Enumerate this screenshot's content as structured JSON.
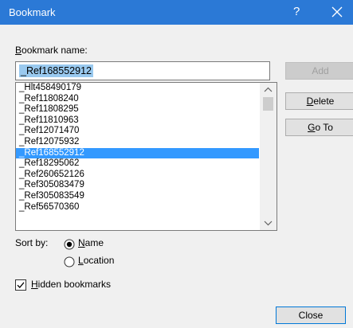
{
  "window": {
    "title": "Bookmark",
    "help": "?",
    "title_bar_color": "#2b79d6"
  },
  "bookmark_name": {
    "label_accel": "B",
    "label_rest": "ookmark name:",
    "value": "_Ref168552912"
  },
  "bookmarks": {
    "items": [
      "_Hlt458490179",
      "_Ref11808240",
      "_Ref11808295",
      "_Ref11810963",
      "_Ref12071470",
      "_Ref12075932",
      "_Ref168552912",
      "_Ref18295062",
      "_Ref260652126",
      "_Ref305083479",
      "_Ref305083549",
      "_Ref56570360"
    ],
    "selected_index": 6,
    "selection_color": "#3399ff"
  },
  "buttons": {
    "add": "Add",
    "delete_accel": "D",
    "delete_rest": "elete",
    "goto_accel": "G",
    "goto_rest": "o To",
    "close": "Close"
  },
  "sort": {
    "label": "Sort by:",
    "name_accel": "N",
    "name_rest": "ame",
    "location_accel": "L",
    "location_rest": "ocation",
    "selected": "name"
  },
  "hidden": {
    "accel": "H",
    "rest": "idden bookmarks",
    "checked": true
  },
  "icons": {
    "close": "close-icon",
    "scroll_up": "chevron-up-icon",
    "scroll_down": "chevron-down-icon",
    "radio_selected": "radio-selected-icon",
    "checkbox": "checkmark-icon"
  }
}
